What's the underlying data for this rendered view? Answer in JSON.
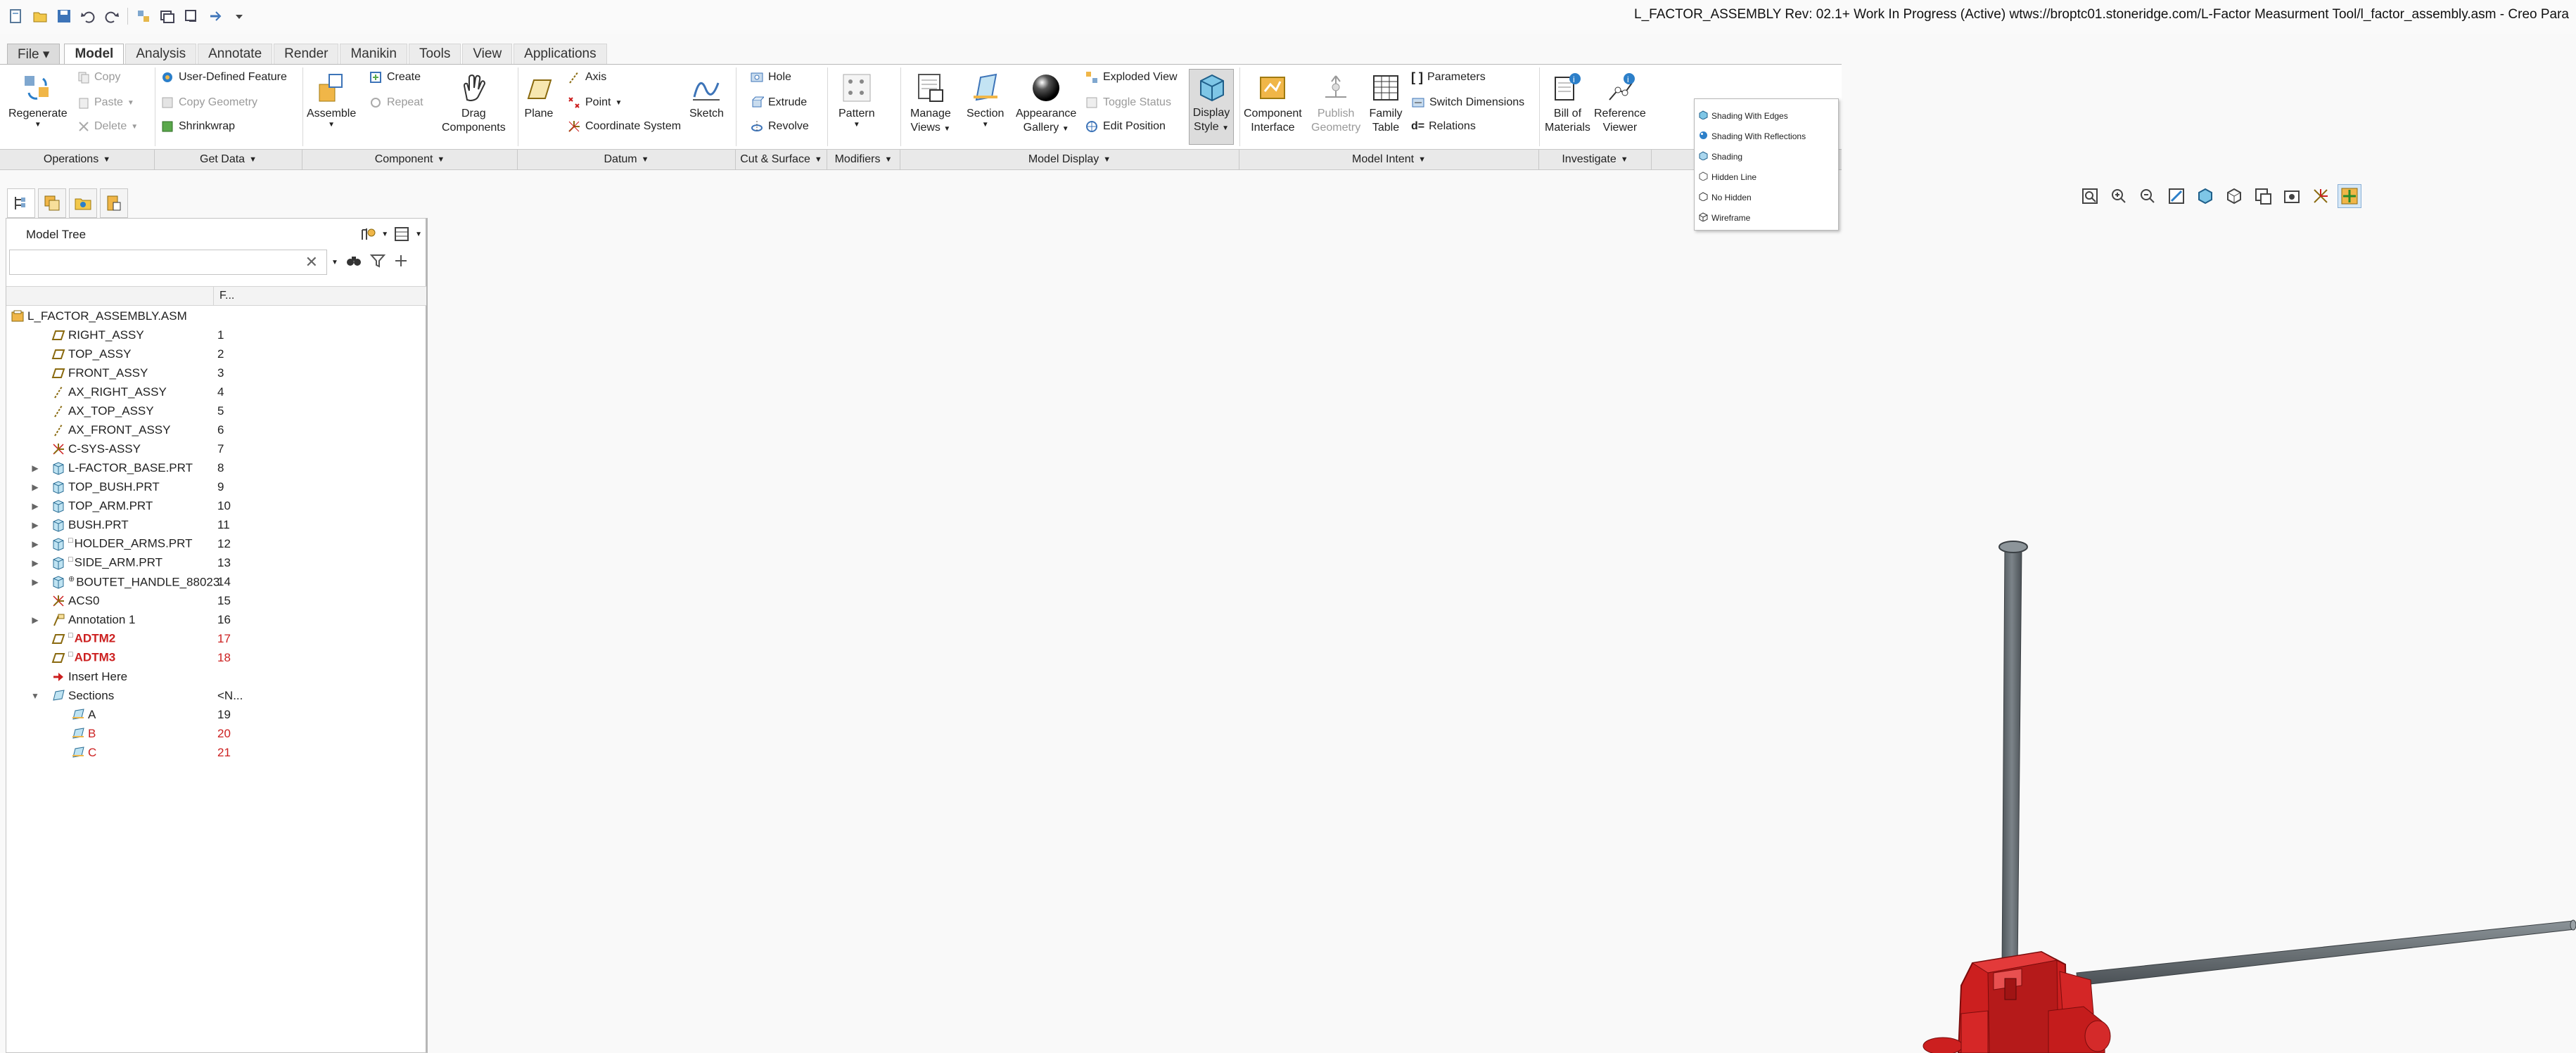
{
  "window": {
    "title": "L_FACTOR_ASSEMBLY Rev: 02.1+ Work In Progress  (Active) wtws://broptc01.stoneridge.com/L-Factor Measurment Tool/l_factor_assembly.asm - Creo Para"
  },
  "quick_access": [
    "new-icon",
    "open-icon",
    "save-icon",
    "undo-icon",
    "redo-icon",
    "regenerate-icon",
    "windows-icon",
    "close-icon",
    "custom-icon",
    "more-icon"
  ],
  "tabs": [
    {
      "label": "File ▾",
      "kind": "file"
    },
    {
      "label": "Model",
      "kind": "active"
    },
    {
      "label": "Analysis",
      "kind": "plain"
    },
    {
      "label": "Annotate",
      "kind": "plain"
    },
    {
      "label": "Render",
      "kind": "plain"
    },
    {
      "label": "Manikin",
      "kind": "plain"
    },
    {
      "label": "Tools",
      "kind": "plain"
    },
    {
      "label": "View",
      "kind": "plain"
    },
    {
      "label": "Applications",
      "kind": "plain"
    }
  ],
  "ribbon": {
    "operations": {
      "regenerate": "Regenerate",
      "copy": "Copy",
      "paste": "Paste",
      "delete": "Delete"
    },
    "get_data": {
      "user_defined_feature": "User-Defined Feature",
      "copy_geometry": "Copy Geometry",
      "shrinkwrap": "Shrinkwrap"
    },
    "component": {
      "assemble": "Assemble",
      "create": "Create",
      "repeat": "Repeat",
      "drag_line1": "Drag",
      "drag_line2": "Components"
    },
    "datum": {
      "plane": "Plane",
      "axis": "Axis",
      "point": "Point",
      "coordinate_system": "Coordinate System",
      "sketch": "Sketch"
    },
    "cut_surface": {
      "hole": "Hole",
      "extrude": "Extrude",
      "revolve": "Revolve"
    },
    "modifiers": {
      "pattern": "Pattern"
    },
    "model_display": {
      "manage_line1": "Manage",
      "manage_line2": "Views",
      "section": "Section",
      "appearance_line1": "Appearance",
      "appearance_line2": "Gallery",
      "exploded_view": "Exploded View",
      "toggle_status": "Toggle Status",
      "edit_position": "Edit Position",
      "display_line1": "Display",
      "display_line2": "Style"
    },
    "model_intent": {
      "component_line1": "Component",
      "component_line2": "Interface",
      "publish_line1": "Publish",
      "publish_line2": "Geometry",
      "family_line1": "Family",
      "family_line2": "Table",
      "parameters": "Parameters",
      "switch_dimensions": "Switch Dimensions",
      "relations": "Relations"
    },
    "investigate": {
      "bom_line1": "Bill of",
      "bom_line2": "Materials",
      "ref_line1": "Reference",
      "ref_line2": "Viewer"
    },
    "groups": [
      "Operations",
      "Get Data",
      "Component",
      "Datum",
      "Cut & Surface",
      "Modifiers",
      "Model Display",
      "Model Intent",
      "Investigate"
    ]
  },
  "display_style_menu": [
    "Shading With Edges",
    "Shading With Reflections",
    "Shading",
    "Hidden Line",
    "No Hidden",
    "Wireframe"
  ],
  "model_tree": {
    "title": "Model Tree",
    "search_placeholder": "",
    "column_header": "F...",
    "rows": [
      {
        "label": "L_FACTOR_ASSEMBLY.ASM",
        "num": "",
        "icon": "assembly-icon",
        "indent": 0,
        "exp": "",
        "style": ""
      },
      {
        "label": "RIGHT_ASSY",
        "num": "1",
        "icon": "datum-plane-icon",
        "indent": 1,
        "exp": "",
        "style": ""
      },
      {
        "label": "TOP_ASSY",
        "num": "2",
        "icon": "datum-plane-icon",
        "indent": 1,
        "exp": "",
        "style": ""
      },
      {
        "label": "FRONT_ASSY",
        "num": "3",
        "icon": "datum-plane-icon",
        "indent": 1,
        "exp": "",
        "style": ""
      },
      {
        "label": "AX_RIGHT_ASSY",
        "num": "4",
        "icon": "datum-axis-icon",
        "indent": 1,
        "exp": "",
        "style": ""
      },
      {
        "label": "AX_TOP_ASSY",
        "num": "5",
        "icon": "datum-axis-icon",
        "indent": 1,
        "exp": "",
        "style": ""
      },
      {
        "label": "AX_FRONT_ASSY",
        "num": "6",
        "icon": "datum-axis-icon",
        "indent": 1,
        "exp": "",
        "style": ""
      },
      {
        "label": "C-SYS-ASSY",
        "num": "7",
        "icon": "csys-icon",
        "indent": 1,
        "exp": "",
        "style": ""
      },
      {
        "label": "L-FACTOR_BASE.PRT",
        "num": "8",
        "icon": "part-icon",
        "indent": 1,
        "exp": "▶",
        "style": ""
      },
      {
        "label": "TOP_BUSH.PRT",
        "num": "9",
        "icon": "part-icon",
        "indent": 1,
        "exp": "▶",
        "style": ""
      },
      {
        "label": "TOP_ARM.PRT",
        "num": "10",
        "icon": "part-icon",
        "indent": 1,
        "exp": "▶",
        "style": ""
      },
      {
        "label": "BUSH.PRT",
        "num": "11",
        "icon": "part-icon",
        "indent": 1,
        "exp": "▶",
        "style": ""
      },
      {
        "label": "HOLDER_ARMS.PRT",
        "num": "12",
        "icon": "part-icon",
        "indent": 1,
        "exp": "▶",
        "style": "",
        "pre": "□"
      },
      {
        "label": "SIDE_ARM.PRT",
        "num": "13",
        "icon": "part-icon",
        "indent": 1,
        "exp": "▶",
        "style": "",
        "pre": "□"
      },
      {
        "label": "BOUTET_HANDLE_88023",
        "num": "14",
        "icon": "part-icon",
        "indent": 1,
        "exp": "▶",
        "style": "",
        "pre": "⊕"
      },
      {
        "label": "ACS0",
        "num": "15",
        "icon": "csys-icon",
        "indent": 1,
        "exp": "",
        "style": ""
      },
      {
        "label": "Annotation 1",
        "num": "16",
        "icon": "annotation-icon",
        "indent": 1,
        "exp": "▶",
        "style": ""
      },
      {
        "label": "ADTM2",
        "num": "17",
        "icon": "datum-plane-icon",
        "indent": 1,
        "exp": "",
        "style": "red bold",
        "pre": "□"
      },
      {
        "label": "ADTM3",
        "num": "18",
        "icon": "datum-plane-icon",
        "indent": 1,
        "exp": "",
        "style": "red bold",
        "pre": "□"
      },
      {
        "label": "Insert Here",
        "num": "",
        "icon": "insert-arrow-icon",
        "indent": 1,
        "exp": "",
        "style": ""
      },
      {
        "label": "Sections",
        "num": "<N...",
        "icon": "sections-icon",
        "indent": 1,
        "exp": "▼",
        "style": ""
      },
      {
        "label": "A",
        "num": "19",
        "icon": "section-icon",
        "indent": 2,
        "exp": "",
        "style": ""
      },
      {
        "label": "B",
        "num": "20",
        "icon": "section-icon",
        "indent": 2,
        "exp": "",
        "style": "red"
      },
      {
        "label": "C",
        "num": "21",
        "icon": "section-icon",
        "indent": 2,
        "exp": "",
        "style": "red"
      }
    ]
  },
  "graphics_toolbar": [
    "refit-icon",
    "zoom-in-icon",
    "zoom-out-icon",
    "repaint-icon",
    "display-style-icon",
    "saved-orientations-icon",
    "view-manager-icon",
    "perspective-icon",
    "datum-display-icon",
    "spin-center-icon"
  ],
  "colors": {
    "part_red": "#cc1f1f",
    "rod_gray": "#6d7479",
    "accent_blue": "#2c7fc9"
  }
}
